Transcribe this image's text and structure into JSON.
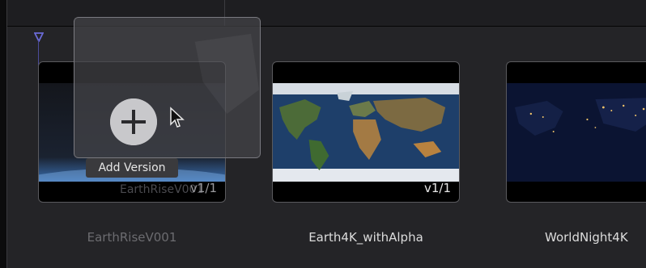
{
  "clips": [
    {
      "name": "EarthRiseV001",
      "version": "v1/1",
      "overlay_label": "EarthRiseV001"
    },
    {
      "name": "Earth4K_withAlpha",
      "version": "v1/1"
    },
    {
      "name": "WorldNight4K"
    }
  ],
  "drag_overlay": {
    "tooltip": "Add Version",
    "icon": "plus-icon"
  },
  "colors": {
    "background": "#242427",
    "playhead": "#6b6bd8"
  }
}
